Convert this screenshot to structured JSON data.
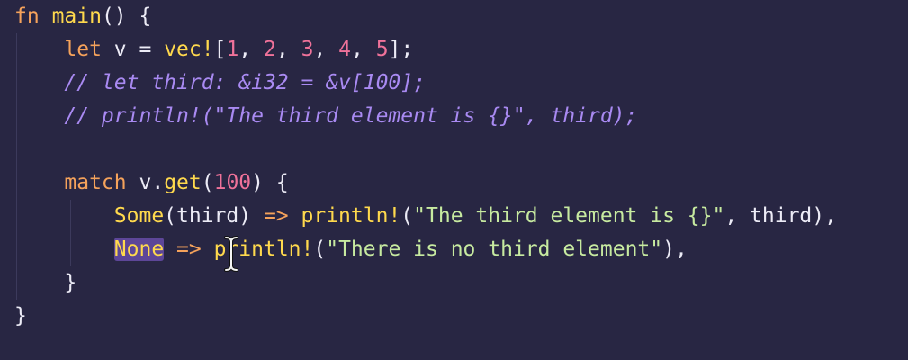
{
  "editor": {
    "lines": [
      {
        "tokens": [
          {
            "text": "fn",
            "type": "kw"
          },
          {
            "text": " ",
            "type": "ws"
          },
          {
            "text": "main",
            "type": "fn"
          },
          {
            "text": "() {",
            "type": "punc"
          }
        ]
      },
      {
        "tokens": [
          {
            "text": "    ",
            "type": "ws"
          },
          {
            "text": "let",
            "type": "kw"
          },
          {
            "text": " v = ",
            "type": "var"
          },
          {
            "text": "vec!",
            "type": "fn"
          },
          {
            "text": "[",
            "type": "punc"
          },
          {
            "text": "1",
            "type": "num"
          },
          {
            "text": ", ",
            "type": "punc"
          },
          {
            "text": "2",
            "type": "num"
          },
          {
            "text": ", ",
            "type": "punc"
          },
          {
            "text": "3",
            "type": "num"
          },
          {
            "text": ", ",
            "type": "punc"
          },
          {
            "text": "4",
            "type": "num"
          },
          {
            "text": ", ",
            "type": "punc"
          },
          {
            "text": "5",
            "type": "num"
          },
          {
            "text": "];",
            "type": "punc"
          }
        ]
      },
      {
        "tokens": [
          {
            "text": "    ",
            "type": "ws"
          },
          {
            "text": "// let third: &i32 = &v[100];",
            "type": "cmt"
          }
        ]
      },
      {
        "tokens": [
          {
            "text": "    ",
            "type": "ws"
          },
          {
            "text": "// println!(\"The third element is {}\", third);",
            "type": "cmt"
          }
        ]
      },
      {
        "tokens": []
      },
      {
        "tokens": [
          {
            "text": "    ",
            "type": "ws"
          },
          {
            "text": "match",
            "type": "kw"
          },
          {
            "text": " v.",
            "type": "var"
          },
          {
            "text": "get",
            "type": "fn"
          },
          {
            "text": "(",
            "type": "punc"
          },
          {
            "text": "100",
            "type": "num"
          },
          {
            "text": ") {",
            "type": "punc"
          }
        ]
      },
      {
        "tokens": [
          {
            "text": "        ",
            "type": "ws"
          },
          {
            "text": "Some",
            "type": "variant"
          },
          {
            "text": "(third) ",
            "type": "var"
          },
          {
            "text": "=>",
            "type": "op"
          },
          {
            "text": " ",
            "type": "ws"
          },
          {
            "text": "println!",
            "type": "fn"
          },
          {
            "text": "(",
            "type": "punc"
          },
          {
            "text": "\"The third element is {}\"",
            "type": "str"
          },
          {
            "text": ", third),",
            "type": "punc"
          }
        ]
      },
      {
        "tokens": [
          {
            "text": "        ",
            "type": "ws"
          },
          {
            "text": "None",
            "type": "variant",
            "highlight": true
          },
          {
            "text": " ",
            "type": "ws"
          },
          {
            "text": "=>",
            "type": "op"
          },
          {
            "text": " ",
            "type": "ws"
          },
          {
            "text": "println!",
            "type": "fn"
          },
          {
            "text": "(",
            "type": "punc"
          },
          {
            "text": "\"There is no third element\"",
            "type": "str"
          },
          {
            "text": "),",
            "type": "punc"
          }
        ]
      },
      {
        "tokens": [
          {
            "text": "    ",
            "type": "ws"
          },
          {
            "text": "}",
            "type": "punc"
          }
        ]
      },
      {
        "tokens": [
          {
            "text": "}",
            "type": "punc"
          }
        ]
      }
    ]
  },
  "colors": {
    "background": "#282643",
    "keyword": "#f5a25b",
    "function": "#ffd94d",
    "number": "#f0729a",
    "string": "#c7eaa0",
    "comment": "#a98af2",
    "text": "#ecebf6",
    "selection_highlight": "#5d4698"
  },
  "cursor": {
    "icon": "text-cursor-ibeam-icon"
  }
}
